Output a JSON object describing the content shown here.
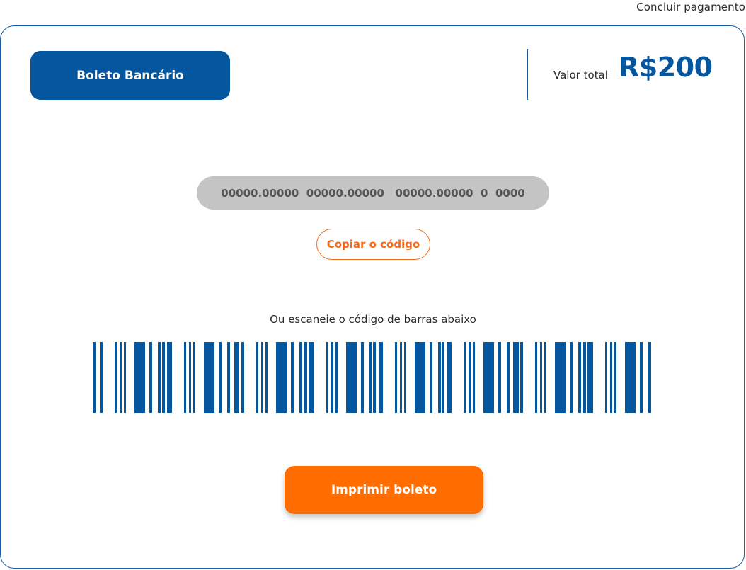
{
  "header": {
    "finish_link": "Concluir pagamento"
  },
  "payment": {
    "method_label": "Boleto Bancário",
    "total_label": "Valor total",
    "total_value": "R$200"
  },
  "boleto": {
    "code": "00000.00000  00000.00000   00000.00000  0  0000",
    "copy_label": "Copiar o código",
    "scan_label": "Ou escaneie o código de barras abaixo",
    "print_label": "Imprimir boleto"
  },
  "colors": {
    "primary": "#04569f",
    "accent": "#ff6c00",
    "code_bg": "#c4c4c4"
  }
}
